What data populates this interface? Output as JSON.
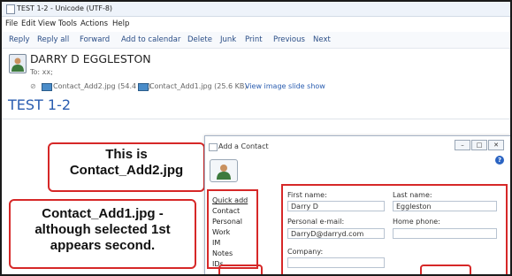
{
  "window": {
    "title": "TEST 1-2 - Unicode (UTF-8)"
  },
  "menu": [
    "File",
    "Edit",
    "View",
    "Tools",
    "Actions",
    "Help"
  ],
  "toolbar": [
    "Reply",
    "Reply all",
    "Forward",
    "Add to calendar",
    "Delete",
    "Junk",
    "Print",
    "Previous",
    "Next"
  ],
  "message": {
    "sender": "DARRY D EGGLESTON",
    "to": "To: xx;",
    "attachments": [
      {
        "name": "Contact_Add2.jpg (54.4 KB)"
      },
      {
        "name": "Contact_Add1.jpg (25.6 KB)"
      }
    ],
    "slideshow_link": "View image slide show",
    "subject": "TEST 1-2"
  },
  "callouts": {
    "top": [
      "This is",
      "Contact_Add2.jpg"
    ],
    "bottom": [
      "Contact_Add1.jpg -",
      "although selected 1st",
      "appears second."
    ]
  },
  "dialog": {
    "title": "Add a Contact",
    "window_buttons": [
      "–",
      "□",
      "✕"
    ],
    "help": "?",
    "nav": [
      "Quick add",
      "Contact",
      "Personal",
      "Work",
      "IM",
      "Notes",
      "IDs"
    ],
    "fields": {
      "first_name_label": "First name:",
      "first_name_value": "Darry D",
      "last_name_label": "Last name:",
      "last_name_value": "Eggleston",
      "email_label": "Personal e-mail:",
      "email_value": "DarryD@darryd.com",
      "home_phone_label": "Home phone:",
      "company_label": "Company:"
    }
  },
  "colors": {
    "accent": "#2a5db0",
    "callout_border": "#d62828",
    "link": "#2a5db0"
  },
  "icons": [
    "window-icon",
    "person-avatar-icon",
    "paperclip-icon",
    "image-file-icon",
    "help-icon"
  ]
}
